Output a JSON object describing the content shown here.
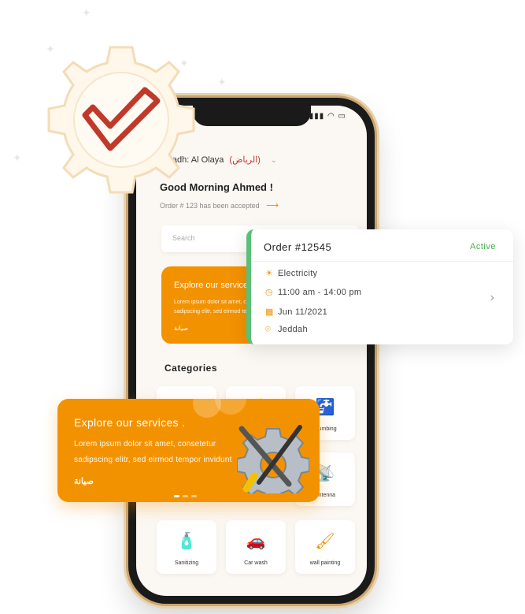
{
  "phone": {
    "location_label": "Riyadh: Al Olaya",
    "location_arabic": "(الرياض)",
    "greeting": "Good Morning Ahmed !",
    "order_notice": "Order # 123 has been accepted",
    "search_placeholder": "Search",
    "inner_banner": {
      "title": "Explore our services",
      "desc_line1": "Lorem ipsum dolor sit amet, co",
      "desc_line2": "sadipscing elitr, sed eirmod ter",
      "logo_text": "صيانة"
    },
    "categories_title": "Categories",
    "categories": [
      {
        "label": "",
        "icon": "ac-icon"
      },
      {
        "label": "",
        "icon": "electric-icon"
      },
      {
        "label": "Plumbing",
        "icon": "plumbing-icon"
      },
      {
        "label": "Antenna",
        "icon": "antenna-icon"
      },
      {
        "label": "Sanitizing",
        "icon": "sanitizing-icon"
      },
      {
        "label": "Car wash",
        "icon": "car-wash-icon"
      },
      {
        "label": "wall painting",
        "icon": "paint-roller-icon"
      }
    ]
  },
  "order_card": {
    "title": "Order #12545",
    "status": "Active",
    "service": "Electricity",
    "time": "11:00 am - 14:00 pm",
    "date": "Jun 11/2021",
    "city": "Jeddah"
  },
  "explore_banner": {
    "title": "Explore our services .",
    "desc_line1": "Lorem ipsum dolor sit amet, consetetur",
    "desc_line2": "sadipscing elitr, sed eirmod tempor invidunt",
    "logo_text": "صيانة"
  },
  "colors": {
    "accent": "#f39200",
    "active": "#4caf50",
    "check": "#c0392b"
  }
}
